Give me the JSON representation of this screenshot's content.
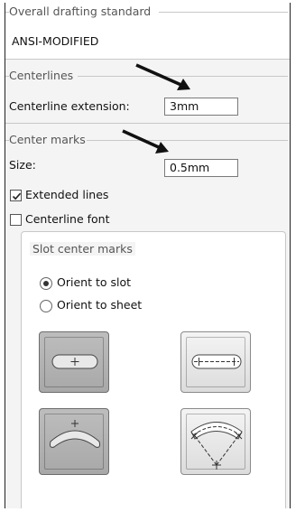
{
  "standard": {
    "title": "Overall drafting standard",
    "value": "ANSI-MODIFIED"
  },
  "centerlines": {
    "title": "Centerlines",
    "extension_label": "Centerline extension:",
    "extension_value": "3mm"
  },
  "center_marks": {
    "title": "Center marks",
    "size_label": "Size:",
    "size_value": "0.5mm",
    "extended_lines_label": "Extended lines",
    "extended_lines_checked": true,
    "centerline_font_label": "Centerline font",
    "centerline_font_checked": false
  },
  "slot_center_marks": {
    "title": "Slot center marks",
    "orient_to_slot_label": "Orient to slot",
    "orient_to_sheet_label": "Orient to sheet",
    "selected_orientation": "Orient to slot",
    "buttons": [
      {
        "icon": "straight-slot-center-icon",
        "selected": true
      },
      {
        "icon": "straight-slot-centerline-icon",
        "selected": false
      },
      {
        "icon": "arc-slot-center-icon",
        "selected": true
      },
      {
        "icon": "arc-slot-centerline-icon",
        "selected": false
      }
    ]
  },
  "annotation_color": "#111111"
}
